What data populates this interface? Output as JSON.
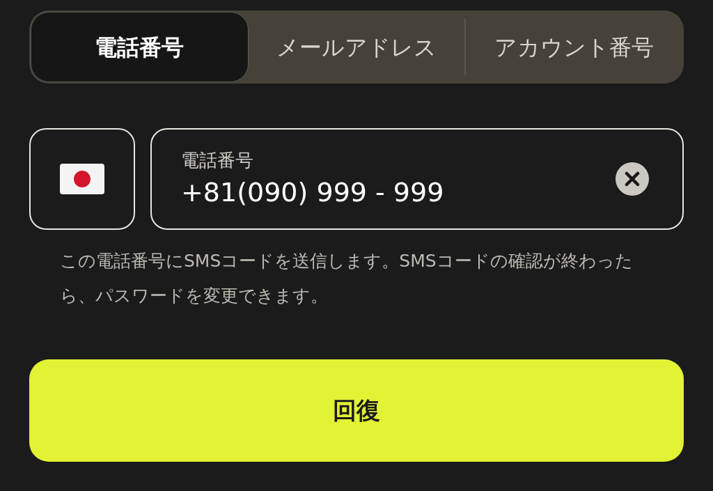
{
  "tabs": [
    {
      "label": "電話番号",
      "selected": true
    },
    {
      "label": "メールアドレス",
      "selected": false
    },
    {
      "label": "アカウント番号",
      "selected": false
    }
  ],
  "phone_field": {
    "label": "電話番号",
    "value": "+81(090) 999 - 999"
  },
  "hint": "この電話番号にSMSコードを送信します。SMSコードの確認が終わったら、パスワードを変更できます。",
  "submit_button": "回復"
}
